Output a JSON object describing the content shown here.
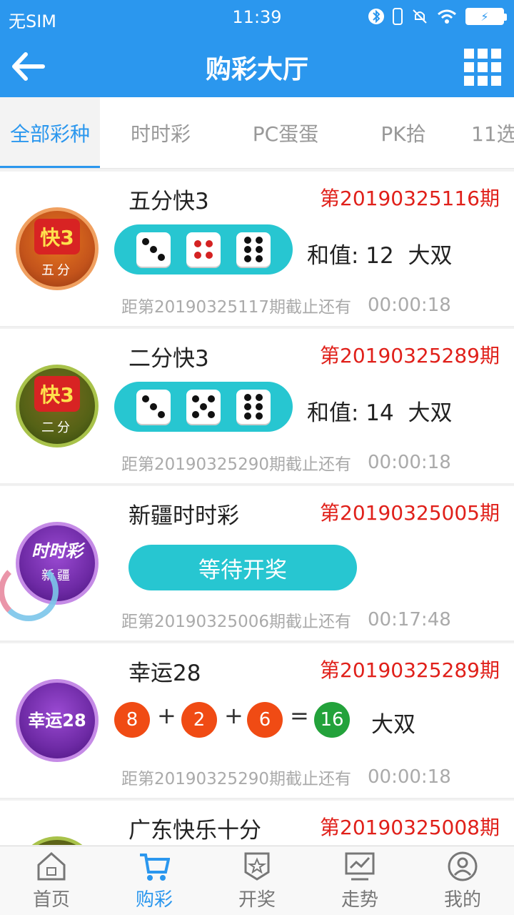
{
  "status": {
    "carrier": "无SIM",
    "time": "11:39"
  },
  "header": {
    "title": "购彩大厅"
  },
  "tabs": [
    {
      "label": "全部彩种",
      "active": true
    },
    {
      "label": "时时彩",
      "active": false
    },
    {
      "label": "PC蛋蛋",
      "active": false
    },
    {
      "label": "PK拾",
      "active": false
    },
    {
      "label": "11选",
      "active": false
    }
  ],
  "items": [
    {
      "title": "五分快3",
      "issue": "第20190325116期",
      "badge_main": "快3",
      "badge_sub": "五分",
      "dice": [
        3,
        4,
        6
      ],
      "sum_text": "和值: 12  大双",
      "countdown_label": "距第20190325117期截止还有",
      "countdown": "00:00:18"
    },
    {
      "title": "二分快3",
      "issue": "第20190325289期",
      "badge_main": "快3",
      "badge_sub": "二分",
      "dice": [
        3,
        5,
        6
      ],
      "sum_text": "和值: 14  大双",
      "countdown_label": "距第20190325290期截止还有",
      "countdown": "00:00:18"
    },
    {
      "title": "新疆时时彩",
      "issue": "第20190325005期",
      "badge_main": "时时彩",
      "badge_sub": "新疆",
      "wait_text": "等待开奖",
      "countdown_label": "距第20190325006期截止还有",
      "countdown": "00:17:48"
    },
    {
      "title": "幸运28",
      "issue": "第20190325289期",
      "badge_main": "幸运28",
      "balls": [
        "8",
        "2",
        "6"
      ],
      "total": "16",
      "ops": [
        "+",
        "+",
        "="
      ],
      "result": "大双",
      "countdown_label": "距第20190325290期截止还有",
      "countdown": "00:00:18"
    },
    {
      "title": "广东快乐十分",
      "issue": "第20190325008期"
    }
  ],
  "bottom_nav": [
    {
      "label": "首页",
      "icon": "home-icon",
      "active": false
    },
    {
      "label": "购彩",
      "icon": "cart-icon",
      "active": true
    },
    {
      "label": "开奖",
      "icon": "award-icon",
      "active": false
    },
    {
      "label": "走势",
      "icon": "trend-icon",
      "active": false
    },
    {
      "label": "我的",
      "icon": "profile-icon",
      "active": false
    }
  ],
  "colors": {
    "primary": "#2b97ee",
    "issue_red": "#e0201a",
    "teal": "#27c6d1",
    "ball_red": "#f04b14",
    "ball_green": "#23a23b"
  }
}
